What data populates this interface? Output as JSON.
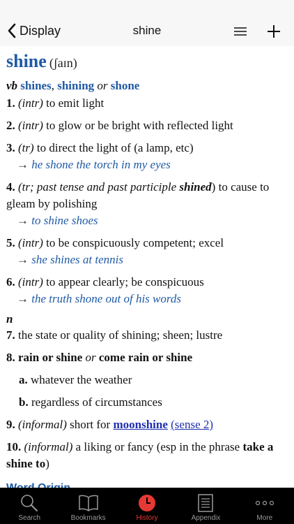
{
  "nav": {
    "back_label": "Display",
    "title": "shine"
  },
  "entry": {
    "headword": "shine",
    "pronunciation": "(ʃaɪn)",
    "forms": {
      "pos": "vb",
      "form1": "shines",
      "comma": ",",
      "form2": "shining",
      "or": "or",
      "form3": "shone"
    },
    "senses": [
      {
        "num": "1.",
        "label": "(intr)",
        "text": " to emit light"
      },
      {
        "num": "2.",
        "label": "(intr)",
        "text": " to glow or be bright with reflected light"
      },
      {
        "num": "3.",
        "label": "(tr)",
        "text": " to direct the light of (a lamp, etc)",
        "example": "he shone the torch in my eyes"
      },
      {
        "num": "4.",
        "label_pre": "(tr; past tense and past participle ",
        "label_bold": "shined",
        "label_post": ")",
        "text": " to cause to gleam by polishing",
        "example": "to shine shoes"
      },
      {
        "num": "5.",
        "label": "(intr)",
        "text": " to be conspicuously competent; excel",
        "example": "she shines at tennis"
      },
      {
        "num": "6.",
        "label": "(intr)",
        "text": " to appear clearly; be conspicuous",
        "example": "the truth shone out of his words"
      }
    ],
    "noun_pos": "n",
    "noun_senses": {
      "s7": {
        "num": "7.",
        "text": " the state or quality of shining; sheen; lustre"
      },
      "s8": {
        "num": "8.",
        "phrase1": "rain or shine",
        "or": "or",
        "phrase2": "come rain or shine",
        "sub": [
          {
            "letter": "a.",
            "text": " whatever the weather"
          },
          {
            "letter": "b.",
            "text": " regardless of circumstances"
          }
        ]
      },
      "s9": {
        "num": "9.",
        "label": "(informal)",
        "text": " short for ",
        "link": "moonshine",
        "link2": "(sense 2)"
      },
      "s10": {
        "num": "10.",
        "label": "(informal)",
        "text": " a liking or fancy (esp in the phrase ",
        "phrase": "take a shine to",
        "close": ")"
      }
    },
    "word_origin": "Word Origin"
  },
  "arrow": "→",
  "tabs": [
    {
      "label": "Search",
      "icon": "search-icon"
    },
    {
      "label": "Bookmarks",
      "icon": "book-icon"
    },
    {
      "label": "History",
      "icon": "clock-icon",
      "active": true
    },
    {
      "label": "Appendix",
      "icon": "document-icon"
    },
    {
      "label": "More",
      "icon": "more-icon"
    }
  ],
  "colors": {
    "headword": "#1f5aa6",
    "link": "#1f2fb0",
    "active_tab": "#e53935",
    "tabbar": "#000000"
  }
}
